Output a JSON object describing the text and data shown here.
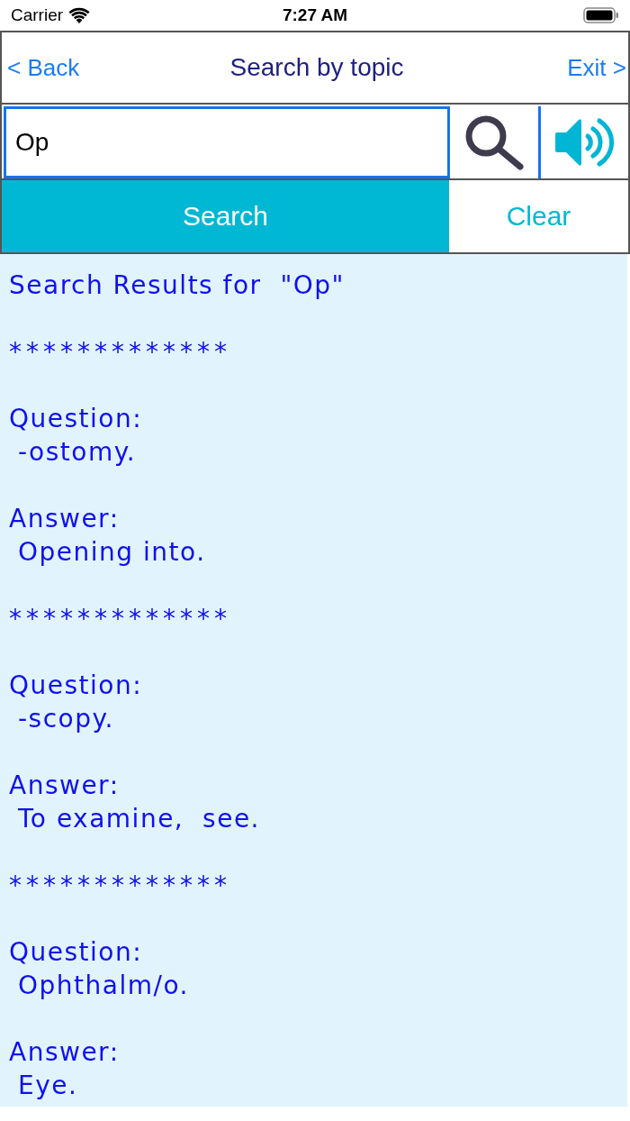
{
  "status_bar": {
    "carrier": "Carrier",
    "time": "7:27 AM"
  },
  "nav_bar": {
    "back": "< Back",
    "title": "Search by topic",
    "exit": "Exit >"
  },
  "search": {
    "value": "Op"
  },
  "buttons": [
    {
      "label": "Search",
      "kind": "primary"
    },
    {
      "label": "Clear",
      "kind": "secondary"
    }
  ],
  "results": {
    "heading": "Search Results for  \"Op\"",
    "entries": [
      {
        "separator": "*************",
        "question_label": "Question:",
        "question": "-ostomy.",
        "answer_label": "Answer:",
        "answer": "Opening into."
      },
      {
        "separator": "*************",
        "question_label": "Question:",
        "question": "-scopy.",
        "answer_label": "Answer:",
        "answer": "To examine,  see."
      },
      {
        "separator": "*************",
        "question_label": "Question:",
        "question": "Ophthalm/o.",
        "answer_label": "Answer:",
        "answer": "Eye."
      }
    ]
  }
}
